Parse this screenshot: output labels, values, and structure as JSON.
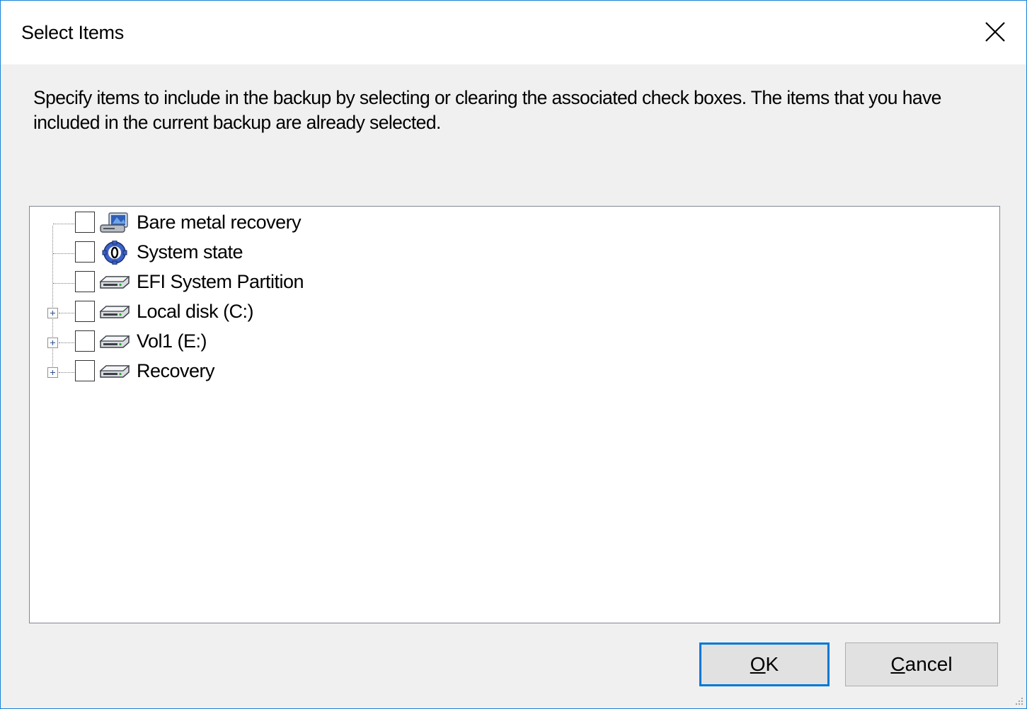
{
  "window": {
    "title": "Select Items",
    "close_glyph": "×"
  },
  "description": "Specify items to include in the backup by selecting or clearing the associated check boxes. The items that you have included in the current backup are already selected.",
  "tree": {
    "items": [
      {
        "label": "Bare metal recovery",
        "icon": "bare-metal-icon",
        "checked": false,
        "expandable": false
      },
      {
        "label": "System state",
        "icon": "system-state-icon",
        "checked": false,
        "expandable": false
      },
      {
        "label": "EFI System Partition",
        "icon": "disk-icon",
        "checked": false,
        "expandable": false
      },
      {
        "label": "Local disk (C:)",
        "icon": "disk-icon",
        "checked": false,
        "expandable": true
      },
      {
        "label": "Vol1 (E:)",
        "icon": "disk-icon",
        "checked": false,
        "expandable": true
      },
      {
        "label": "Recovery",
        "icon": "disk-icon",
        "checked": false,
        "expandable": true
      }
    ]
  },
  "buttons": {
    "ok": {
      "mnemonic": "O",
      "rest": "K"
    },
    "cancel": {
      "mnemonic": "C",
      "rest": "ancel"
    }
  },
  "colors": {
    "accent": "#0078d7",
    "window_border": "#1883d7",
    "background": "#f0f0f0"
  }
}
